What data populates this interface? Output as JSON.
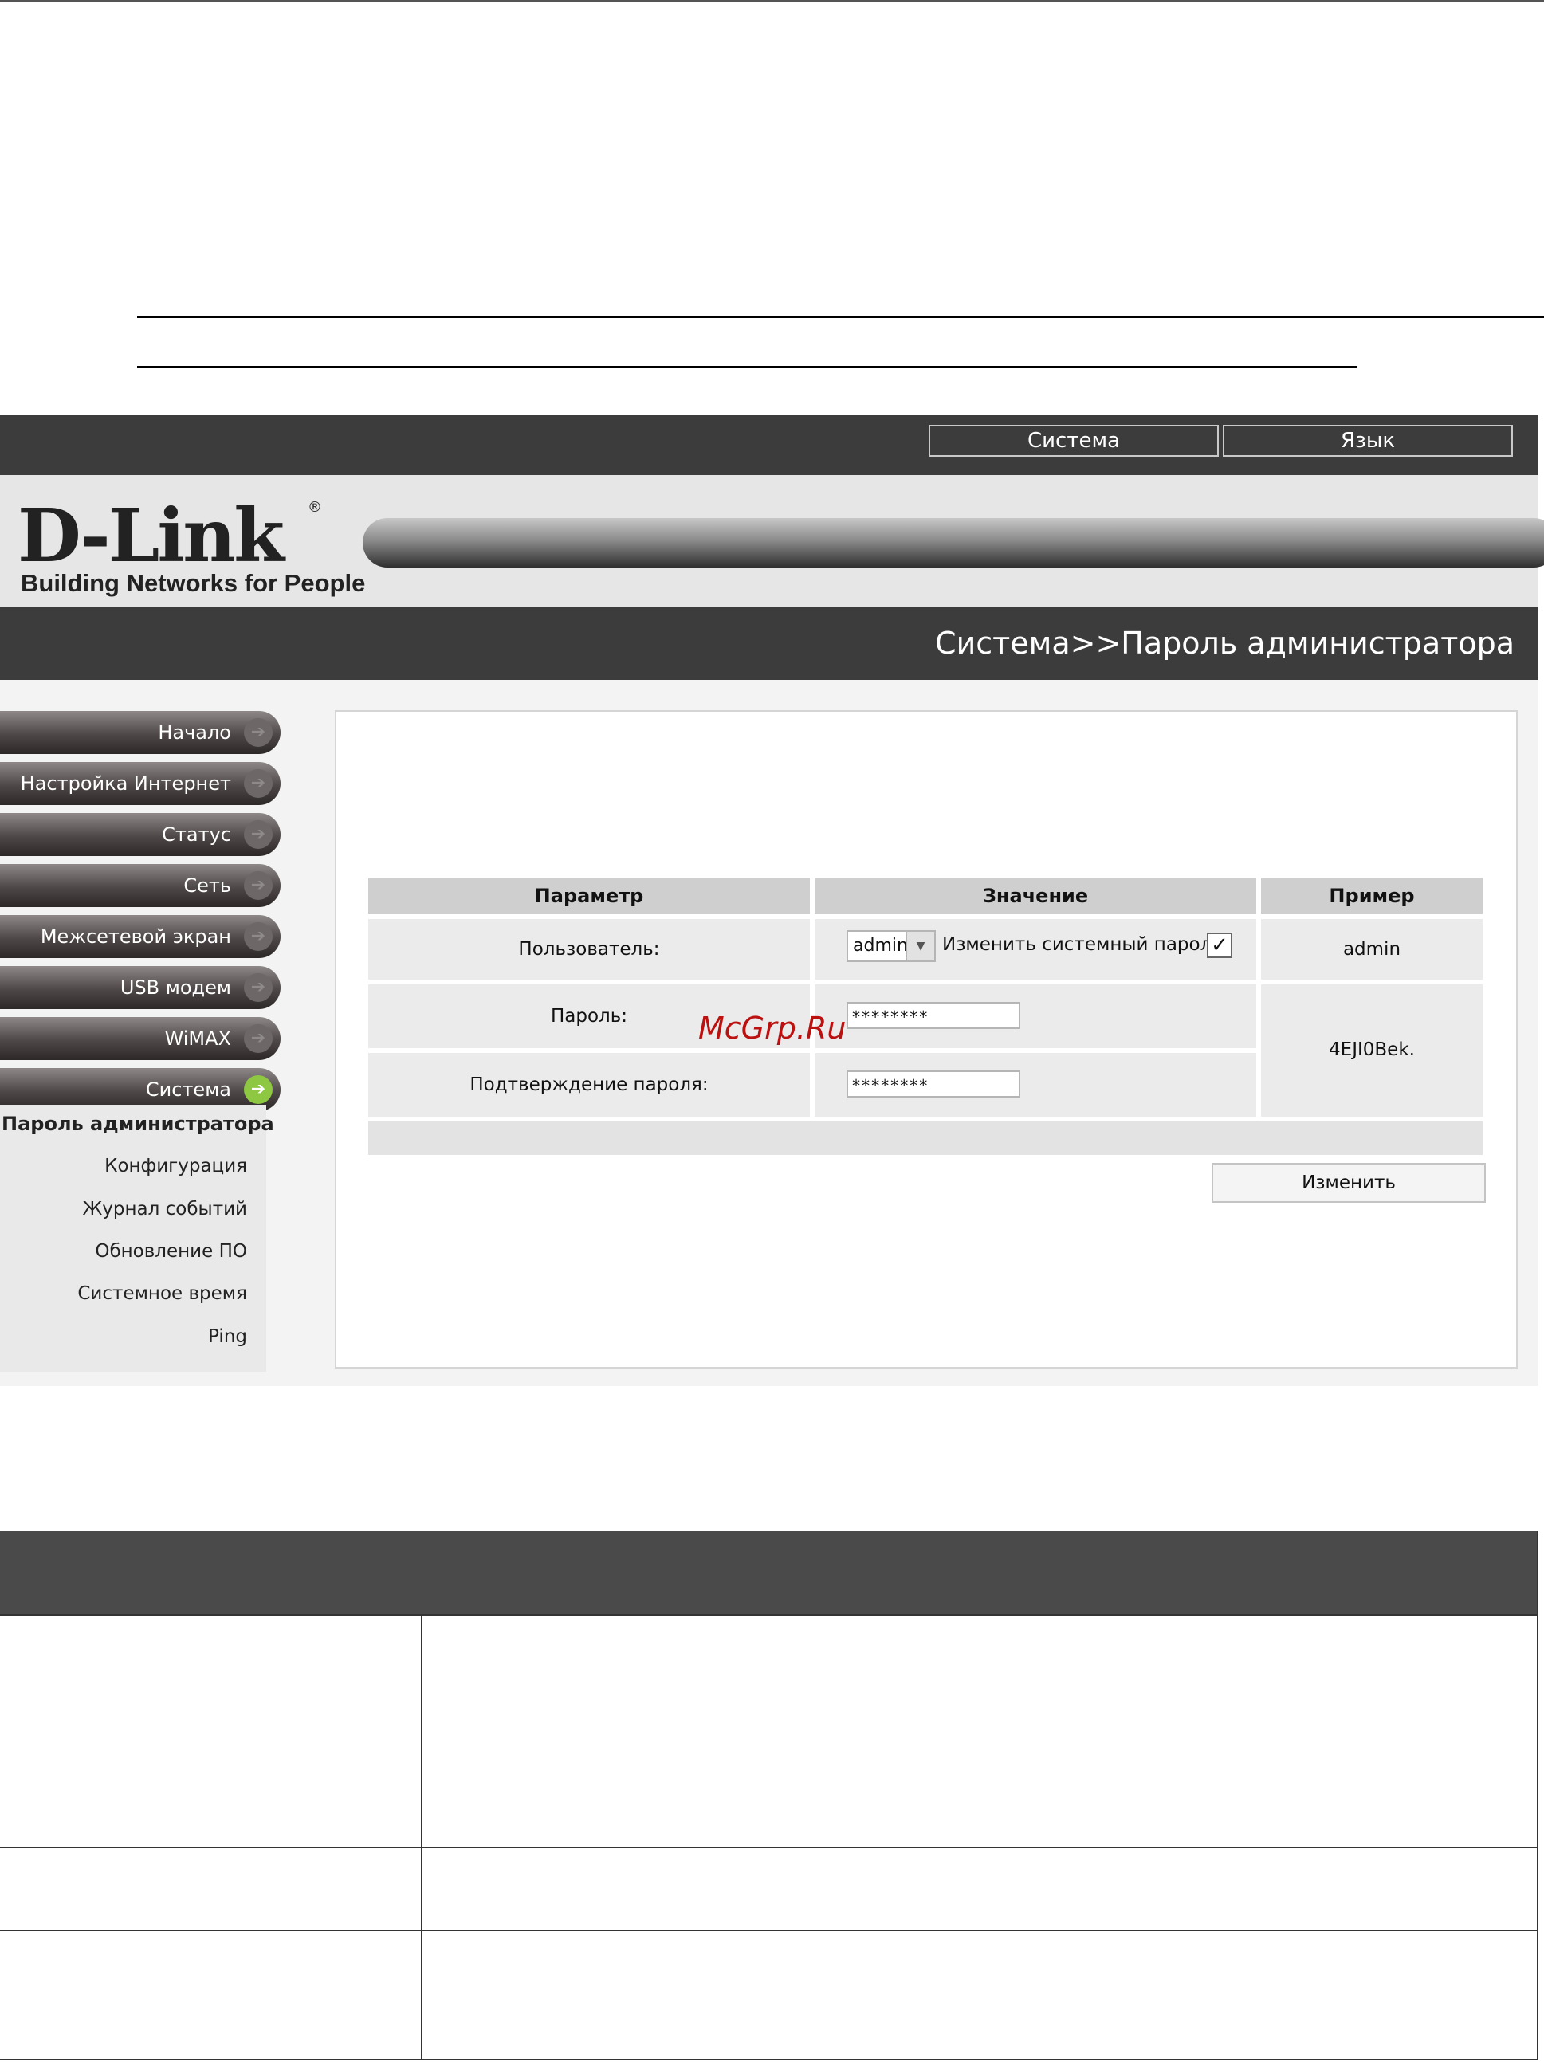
{
  "header": {
    "menu_system": "Система",
    "menu_language": "Язык"
  },
  "logo": {
    "brand": "D-Link",
    "registered": "®",
    "tagline": "Building Networks for People"
  },
  "breadcrumb": "Система>>Пароль администратора",
  "sidebar": {
    "items": [
      "Начало",
      "Настройка Интернет",
      "Статус",
      "Сеть",
      "Межсетевой экран",
      "USB модем",
      "WiMAX",
      "Система"
    ],
    "active_item": "Система",
    "sub_items": [
      "Пароль администратора",
      "Конфигурация",
      "Журнал событий",
      "Обновление ПО",
      "Системное время",
      "Ping"
    ],
    "active_sub_item": "Пароль администратора"
  },
  "table": {
    "headers": [
      "Параметр",
      "Значение",
      "Пример"
    ],
    "user_label": "Пользователь:",
    "user_value": "admin",
    "change_password_label": "Изменить системный пароль:",
    "change_password_checked": true,
    "user_example": "admin",
    "password_label": "Пароль:",
    "password_value": "********",
    "confirm_label": "Подтверждение пароля:",
    "confirm_value": "********",
    "password_example": "4EJI0Bek."
  },
  "apply_button": "Изменить",
  "watermark": "McGrp.Ru",
  "colors": {
    "dark_bar": "#3c3c3c",
    "active_arrow": "#8ec742",
    "table_head": "#4a4a4a",
    "watermark": "#b11111"
  },
  "icons": {
    "nav_arrow": "arrow-right-icon",
    "dropdown": "chevron-down-icon",
    "checkbox": "check-icon"
  }
}
